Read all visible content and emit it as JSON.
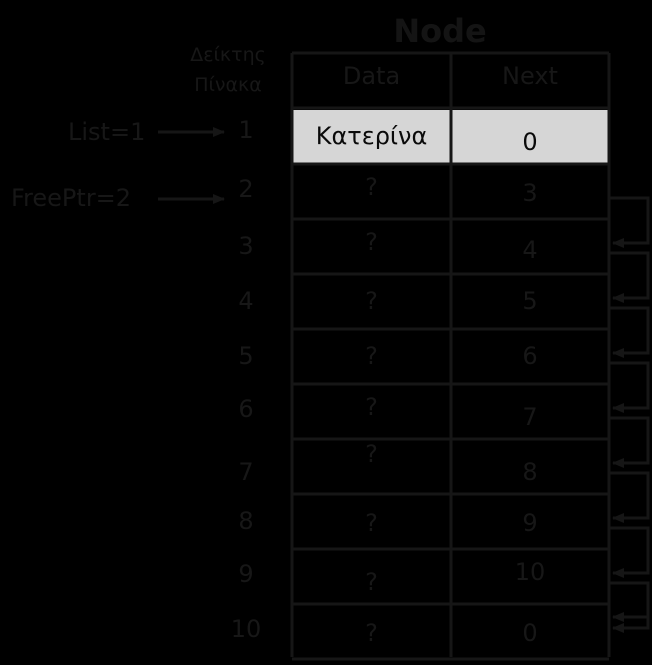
{
  "title": "Node",
  "index_header": [
    "Δείκτης",
    "Πίνακα"
  ],
  "columns": {
    "data": "Data",
    "next": "Next"
  },
  "pointers": [
    {
      "label": "List=1",
      "target_index": 1
    },
    {
      "label": "FreePtr=2",
      "target_index": 2
    }
  ],
  "rows": [
    {
      "index": "1",
      "data": "Κατερίνα",
      "next": "0",
      "highlighted": true
    },
    {
      "index": "2",
      "data": "?",
      "next": "3"
    },
    {
      "index": "3",
      "data": "?",
      "next": "4"
    },
    {
      "index": "4",
      "data": "?",
      "next": "5"
    },
    {
      "index": "5",
      "data": "?",
      "next": "6"
    },
    {
      "index": "6",
      "data": "?",
      "next": "7"
    },
    {
      "index": "7",
      "data": "?",
      "next": "8"
    },
    {
      "index": "8",
      "data": "?",
      "next": "9"
    },
    {
      "index": "9",
      "data": "?",
      "next": "10"
    },
    {
      "index": "10",
      "data": "?",
      "next": "0"
    }
  ],
  "colors": {
    "background": "#000000",
    "foreground": "#161616",
    "highlight": "#d6d6d6"
  }
}
